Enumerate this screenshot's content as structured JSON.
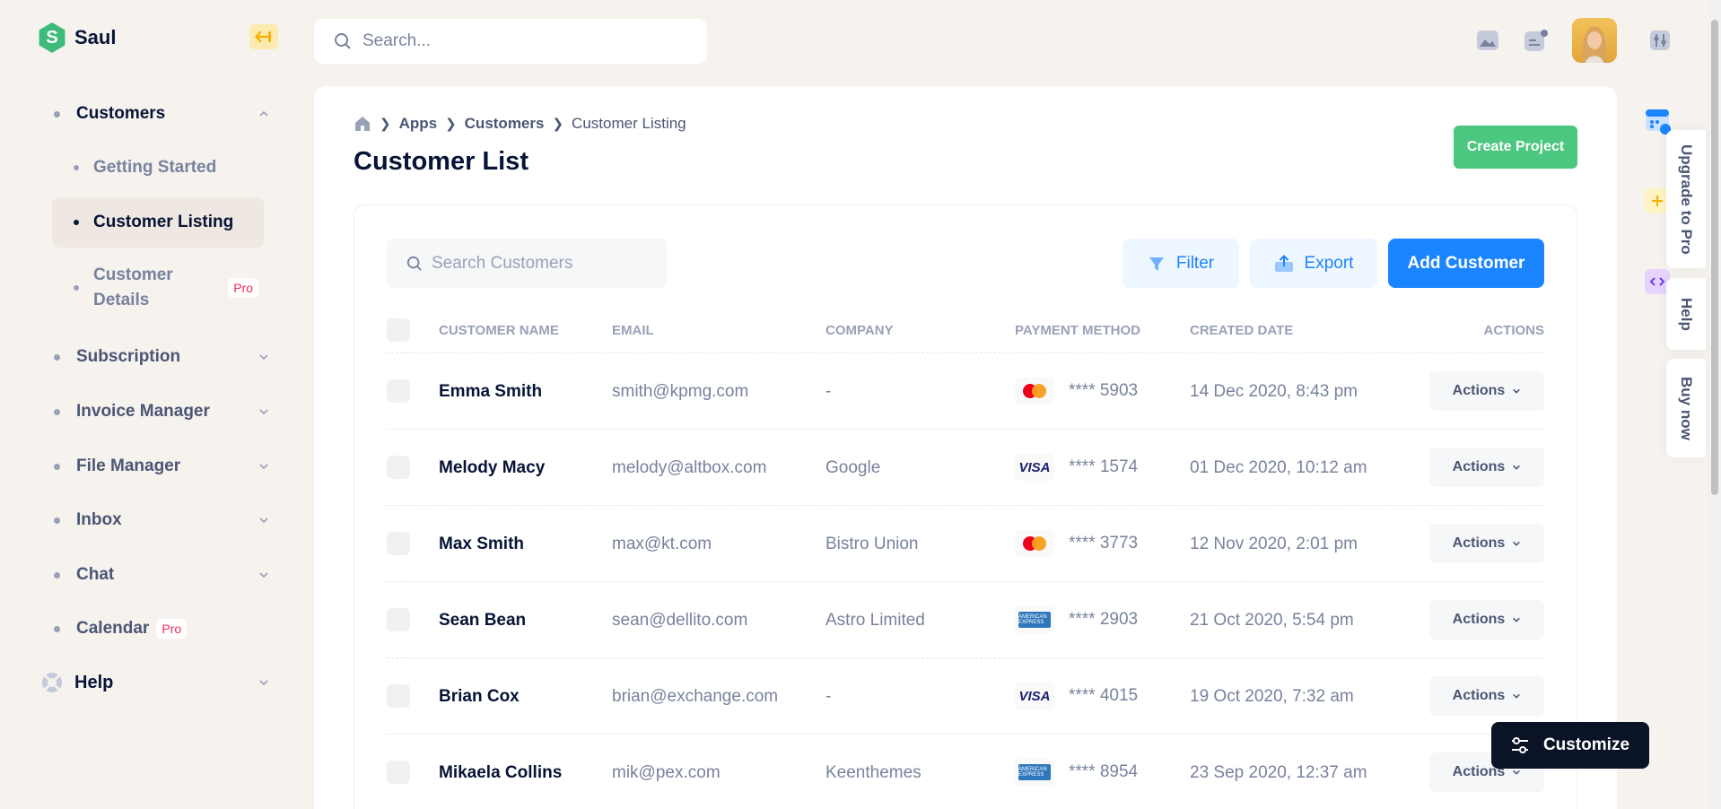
{
  "app": {
    "name": "Saul",
    "logo_letter": "S",
    "brand_color": "#3dbb7a"
  },
  "search": {
    "placeholder": "Search..."
  },
  "sidebar": {
    "customers": {
      "label": "Customers",
      "sub": [
        {
          "label": "Getting Started"
        },
        {
          "label": "Customer Listing",
          "active": true
        },
        {
          "label": "Customer Details",
          "badge": "Pro"
        }
      ]
    },
    "items": [
      {
        "label": "Subscription"
      },
      {
        "label": "Invoice Manager"
      },
      {
        "label": "File Manager"
      },
      {
        "label": "Inbox"
      },
      {
        "label": "Chat"
      },
      {
        "label": "Calendar",
        "badge": "Pro"
      }
    ],
    "help": {
      "label": "Help"
    }
  },
  "breadcrumb": {
    "items": [
      "Apps",
      "Customers"
    ],
    "current": "Customer Listing"
  },
  "page": {
    "title": "Customer List",
    "create_project": "Create Project"
  },
  "toolbar": {
    "search_placeholder": "Search Customers",
    "filter": "Filter",
    "export": "Export",
    "add": "Add Customer"
  },
  "table": {
    "headers": [
      "Customer Name",
      "Email",
      "Company",
      "Payment Method",
      "Created Date",
      "Actions"
    ],
    "rows": [
      {
        "name": "Emma Smith",
        "email": "smith@kpmg.com",
        "company": "-",
        "card": "mastercard",
        "digits": "**** 5903",
        "date": "14 Dec 2020, 8:43 pm",
        "action": "Actions"
      },
      {
        "name": "Melody Macy",
        "email": "melody@altbox.com",
        "company": "Google",
        "card": "visa",
        "digits": "**** 1574",
        "date": "01 Dec 2020, 10:12 am",
        "action": "Actions"
      },
      {
        "name": "Max Smith",
        "email": "max@kt.com",
        "company": "Bistro Union",
        "card": "mastercard",
        "digits": "**** 3773",
        "date": "12 Nov 2020, 2:01 pm",
        "action": "Actions"
      },
      {
        "name": "Sean Bean",
        "email": "sean@dellito.com",
        "company": "Astro Limited",
        "card": "amex",
        "digits": "**** 2903",
        "date": "21 Oct 2020, 5:54 pm",
        "action": "Actions"
      },
      {
        "name": "Brian Cox",
        "email": "brian@exchange.com",
        "company": "-",
        "card": "visa",
        "digits": "**** 4015",
        "date": "19 Oct 2020, 7:32 am",
        "action": "Actions"
      },
      {
        "name": "Mikaela Collins",
        "email": "mik@pex.com",
        "company": "Keenthemes",
        "card": "amex",
        "digits": "**** 8954",
        "date": "23 Sep 2020, 12:37 am",
        "action": "Actions"
      }
    ]
  },
  "card_labels": {
    "visa": "VISA",
    "amex": "AMERICAN EXPRESS"
  },
  "rail": {
    "upgrade": "Upgrade to Pro",
    "help": "Help",
    "buy": "Buy now"
  },
  "customize": {
    "label": "Customize"
  },
  "colors": {
    "primary": "#1b84ff",
    "success": "#4bc77f",
    "danger": "#f8285a",
    "dark": "#071437"
  }
}
